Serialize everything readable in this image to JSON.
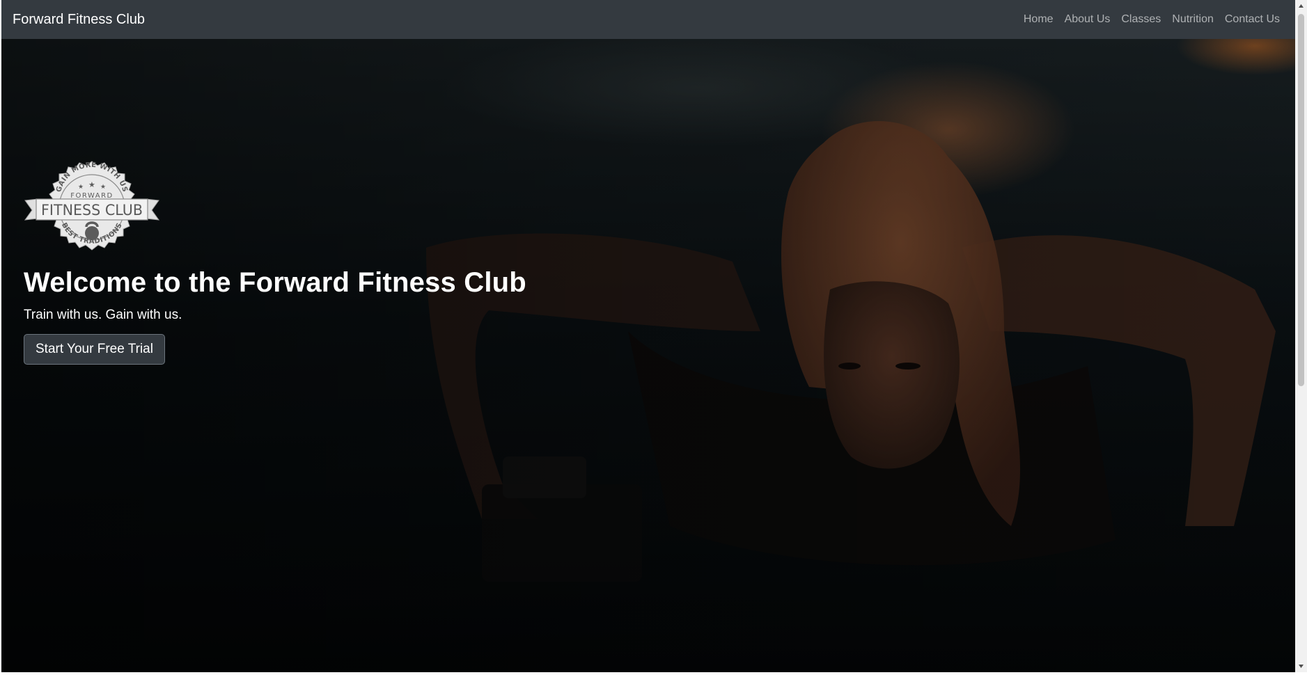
{
  "navbar": {
    "brand": "Forward Fitness Club",
    "links": [
      {
        "label": "Home"
      },
      {
        "label": "About Us"
      },
      {
        "label": "Classes"
      },
      {
        "label": "Nutrition"
      },
      {
        "label": "Contact Us"
      }
    ]
  },
  "hero": {
    "badge": {
      "top_arc": "GAIN MORE WITH US",
      "small_text": "FORWARD",
      "banner": "FITNESS CLUB",
      "bottom_arc": "BEST TRADITIONS"
    },
    "title": "Welcome to the Forward Fitness Club",
    "subtitle": "Train with us. Gain with us.",
    "cta_label": "Start Your Free Trial"
  },
  "colors": {
    "navbar_bg": "#343a40",
    "button_bg": "#343a40",
    "text": "#ffffff",
    "nav_link": "rgba(255,255,255,0.6)"
  },
  "icons": [
    "kettlebell-icon",
    "star-icon",
    "scroll-up-arrow-icon",
    "scroll-down-arrow-icon"
  ]
}
